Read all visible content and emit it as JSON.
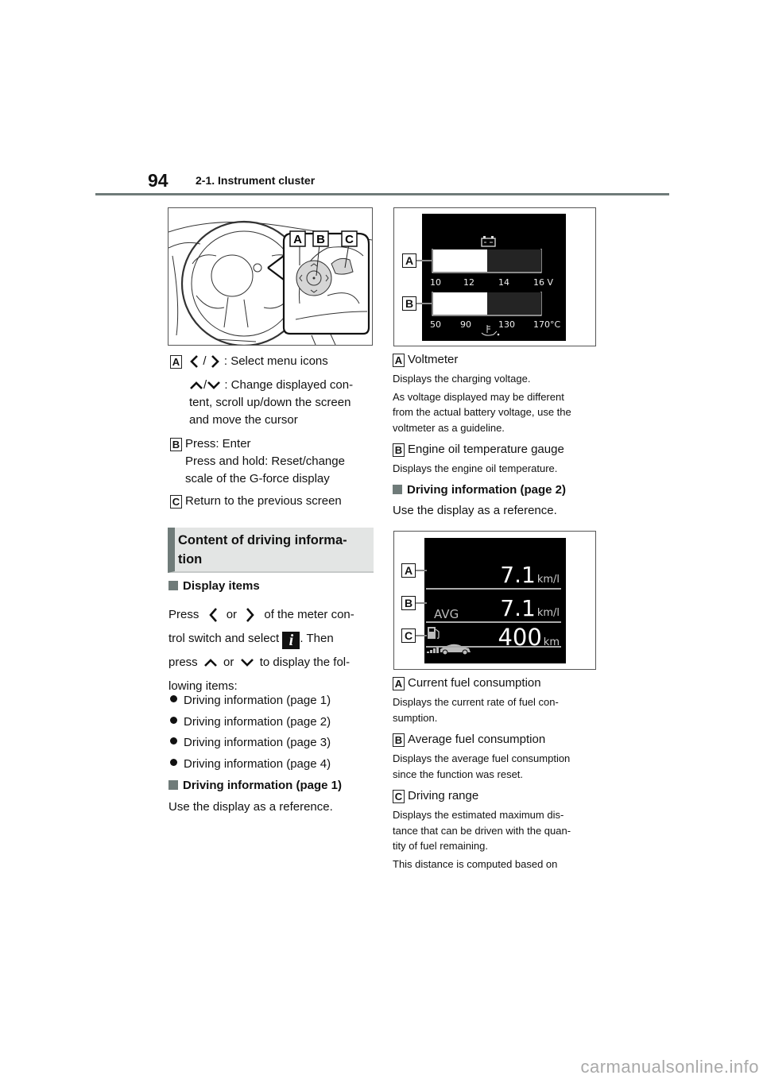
{
  "header": {
    "page_number": "94",
    "section": "2-1. Instrument cluster"
  },
  "figure1": {
    "labels": [
      "A",
      "B",
      "C"
    ],
    "icons": [
      "steering-wheel-illustration",
      "meter-control-switch"
    ]
  },
  "switch_items": {
    "a_label": "A",
    "a_sep": "/",
    "a_text": ": Select menu icons",
    "a2_sep": "/",
    "a2_text": ": Change displayed con-",
    "a2_line2": "tent, scroll up/down the screen",
    "a2_line3": "and move the cursor",
    "b_label": "B",
    "b_line1": "Press: Enter",
    "b_line2": "Press and hold: Reset/change",
    "b_line3": "scale of the G-force display",
    "c_label": "C",
    "c_text": "Return to the previous screen"
  },
  "content_heading": {
    "line1": "Content of driving informa-",
    "line2": "tion"
  },
  "display_items": {
    "title": "Display items",
    "p1_a": "Press",
    "p1_b": "or",
    "p1_c": "of the meter con-",
    "p2_a": "trol switch and select",
    "p2_icon": "i",
    "p2_b": ". Then",
    "p3_a": "press",
    "p3_b": "or",
    "p3_c": "to display the fol-",
    "p4": "lowing items:",
    "items": [
      "Driving information (page 1)",
      "Driving information (page 2)",
      "Driving information (page 3)",
      "Driving information (page 4)"
    ]
  },
  "page1_section": {
    "title": "Driving information (page 1)",
    "text": "Use the display as a reference."
  },
  "gauge_figure": {
    "label_a": "A",
    "label_b": "B",
    "voltage_ticks": [
      "10",
      "12",
      "14",
      "16 V"
    ],
    "temp_ticks": [
      "50",
      "90",
      "130",
      "170°C"
    ],
    "voltage_fill_fraction": 0.5,
    "temp_fill_fraction": 0.5
  },
  "page1_items": {
    "a_label": "A",
    "a_title": "Voltmeter",
    "a_desc1": "Displays the charging voltage.",
    "a_desc2_l1": "As voltage displayed may be different",
    "a_desc2_l2": "from the actual battery voltage, use the",
    "a_desc2_l3": "voltmeter as a guideline.",
    "b_label": "B",
    "b_title": "Engine oil temperature gauge",
    "b_desc": "Displays the engine oil temperature."
  },
  "page2_section": {
    "title": "Driving information (page 2)",
    "text": "Use the display as a reference."
  },
  "fuel_figure": {
    "label_a": "A",
    "label_b": "B",
    "label_c": "C",
    "current_value": "7.1",
    "current_unit": "km/l",
    "avg_label": "AVG",
    "avg_value": "7.1",
    "avg_unit": "km/l",
    "range_value": "400",
    "range_unit": "km"
  },
  "page2_items": {
    "a_label": "A",
    "a_title": "Current fuel consumption",
    "a_desc_l1": "Displays the current rate of fuel con-",
    "a_desc_l2": "sumption.",
    "b_label": "B",
    "b_title": "Average fuel consumption",
    "b_desc_l1": "Displays the average fuel consumption",
    "b_desc_l2": "since the function was reset.",
    "c_label": "C",
    "c_title": "Driving range",
    "c_desc_l1": "Displays the estimated maximum dis-",
    "c_desc_l2": "tance that can be driven with the quan-",
    "c_desc_l3": "tity of fuel remaining.",
    "c_desc2": "This distance is computed based on"
  },
  "watermark": "carmanualsonline.info"
}
